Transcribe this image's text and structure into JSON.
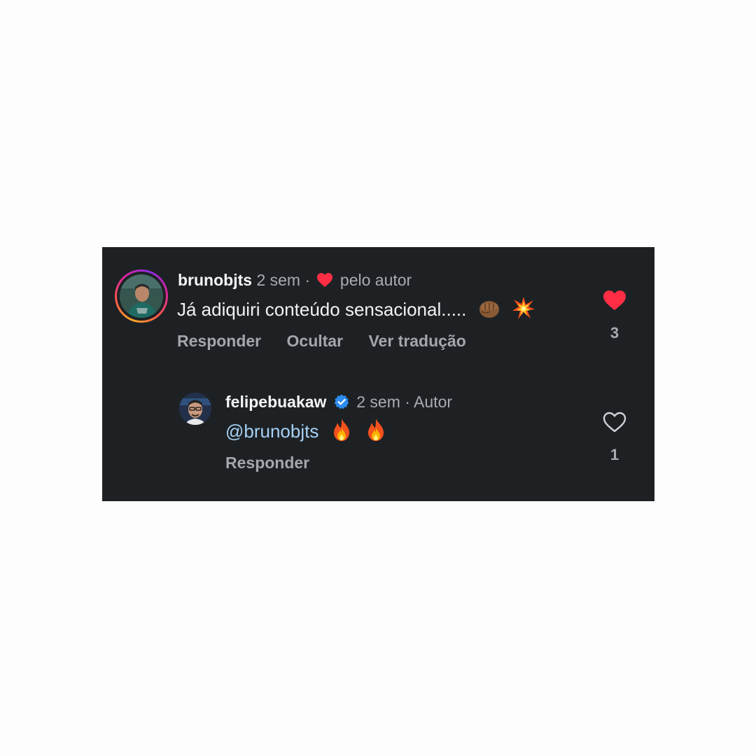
{
  "comments": [
    {
      "username": "brunobjts",
      "time": "2 sem",
      "separator": "·",
      "badge_text": "pelo autor",
      "text": "Já adiquiri conteúdo sensacional.....",
      "emojis": [
        "oncoming-fist-emoji",
        "collision-emoji"
      ],
      "actions": [
        "Responder",
        "Ocultar",
        "Ver tradução"
      ],
      "liked": true,
      "like_count": "3"
    },
    {
      "username": "felipebuakaw",
      "verified": true,
      "time": "2 sem",
      "separator": "·",
      "badge_text": "Autor",
      "mention": "@brunobjts",
      "emojis": [
        "fire-emoji",
        "fire-emoji"
      ],
      "actions": [
        "Responder"
      ],
      "liked": false,
      "like_count": "1"
    }
  ],
  "colors": {
    "background": "#1e2124",
    "like_red": "#ff2e45",
    "verified_blue": "#2d8cf0",
    "mention": "#a6d1f6",
    "meta_gray": "#a8abb0"
  }
}
